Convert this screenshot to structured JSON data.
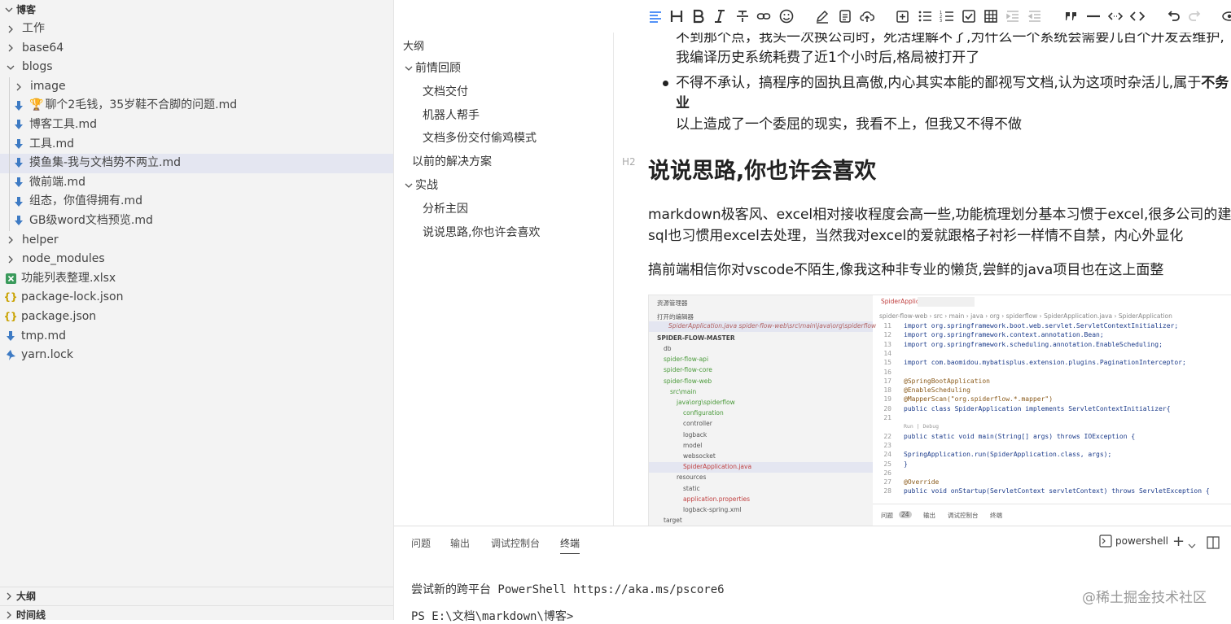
{
  "sidebar": {
    "workspace_title": "博客",
    "items": [
      {
        "label": "工作",
        "type": "folder",
        "state": "collapsed",
        "depth": 0
      },
      {
        "label": "base64",
        "type": "folder",
        "state": "collapsed",
        "depth": 0
      },
      {
        "label": "blogs",
        "type": "folder",
        "state": "expanded",
        "depth": 0
      },
      {
        "label": "image",
        "type": "folder",
        "state": "collapsed",
        "depth": 1
      },
      {
        "label": "聊个2毛钱，35岁鞋不合脚的问题.md",
        "type": "md",
        "depth": 1,
        "trophy": true
      },
      {
        "label": "博客工具.md",
        "type": "md",
        "depth": 1
      },
      {
        "label": "工具.md",
        "type": "md",
        "depth": 1
      },
      {
        "label": "摸鱼集-我与文档势不两立.md",
        "type": "md",
        "depth": 1,
        "selected": true
      },
      {
        "label": "微前端.md",
        "type": "md",
        "depth": 1
      },
      {
        "label": "组态，你值得拥有.md",
        "type": "md",
        "depth": 1
      },
      {
        "label": "GB级word文档预览.md",
        "type": "md",
        "depth": 1
      },
      {
        "label": "helper",
        "type": "folder",
        "state": "collapsed",
        "depth": 0
      },
      {
        "label": "node_modules",
        "type": "folder",
        "state": "collapsed",
        "depth": 0
      },
      {
        "label": "功能列表整理.xlsx",
        "type": "xlsx",
        "depth": 0
      },
      {
        "label": "package-lock.json",
        "type": "json",
        "depth": 0
      },
      {
        "label": "package.json",
        "type": "json",
        "depth": 0
      },
      {
        "label": "tmp.md",
        "type": "md",
        "depth": 0
      },
      {
        "label": "yarn.lock",
        "type": "yarn",
        "depth": 0
      }
    ],
    "outline_section": "大纲",
    "timeline_section": "时间线"
  },
  "toolbar": {
    "icons": [
      "align-icon",
      "heading-icon",
      "bold-icon",
      "italic-icon",
      "strikethrough-icon",
      "link-icon",
      "emoji-icon",
      "edit-icon",
      "export-icon",
      "upload-icon",
      "insert-icon",
      "bullet-list-icon",
      "numbered-list-icon",
      "task-list-icon",
      "table-icon",
      "indent-icon",
      "outdent-icon",
      "quote-icon",
      "hr-icon",
      "inline-code-icon",
      "code-block-icon",
      "undo-icon",
      "redo-icon",
      "preview-icon"
    ]
  },
  "outline": {
    "title": "大纲",
    "items": [
      {
        "label": "前情回顾",
        "level": 1,
        "expandable": true
      },
      {
        "label": "文档交付",
        "level": 2
      },
      {
        "label": "机器人帮手",
        "level": 2
      },
      {
        "label": "文档多份交付偷鸡模式",
        "level": 2
      },
      {
        "label": "以前的解决方案",
        "level": 1
      },
      {
        "label": "实战",
        "level": 1,
        "expandable": true
      },
      {
        "label": "分析主因",
        "level": 2
      },
      {
        "label": "说说思路,你也许会喜欢",
        "level": 2
      }
    ]
  },
  "editor": {
    "line1": "不到那个点，我头一次换公司时，死活理解不了,为什么一个系统会需要几百个开发去维护,",
    "line2": "我编译历史系统耗费了近1个小时后,格局被打开了",
    "bullet_text": "不得不承认，搞程序的固执且高傲,内心其实本能的鄙视写文档,认为这项时杂活儿,属于",
    "bullet_bold": "不务",
    "bullet_bold2": "业",
    "line_after": "以上造成了一个委屈的现实，我看不上，但我又不得不做",
    "h2_tag": "H2",
    "h2": "说说思路,你也许会喜欢",
    "p1_line1": "markdown极客风、excel相对接收程度会高一些,功能梳理划分基本习惯于excel,很多公司的建表",
    "p1_line2": "sql也习惯用excel去处理，当然我对excel的爱就跟格子衬衫一样情不自禁，内心外显化",
    "p2": "搞前端相信你对vscode不陌生,像我这种非专业的懒货,尝鲜的java项目也在这上面整"
  },
  "shot": {
    "explorer_title": "资源管理器",
    "open_editors": "打开的编辑器",
    "open_file": "SpiderApplication.java  spider-flow-web\\src\\main\\java\\org\\spiderflow",
    "project": "SPIDER-FLOW-MASTER",
    "tree": [
      "db",
      "spider-flow-api",
      "spider-flow-core",
      "spider-flow-web",
      "src\\main",
      "java\\org\\spiderflow",
      "configuration",
      "controller",
      "logback",
      "model",
      "websocket",
      "SpiderApplication.java",
      "resources",
      "static",
      "application.properties",
      "logback-spring.xml",
      "target"
    ],
    "tab": "SpiderApplication.java",
    "breadcrumb": "spider-flow-web › src › main › java › org › spiderflow › SpiderApplication.java › SpiderApplication",
    "code_lines": [
      {
        "n": "11",
        "t": "import org.springframework.boot.web.servlet.ServletContextInitializer;"
      },
      {
        "n": "12",
        "t": "import org.springframework.context.annotation.Bean;"
      },
      {
        "n": "13",
        "t": "import org.springframework.scheduling.annotation.EnableScheduling;"
      },
      {
        "n": "14",
        "t": ""
      },
      {
        "n": "15",
        "t": "import com.baomidou.mybatisplus.extension.plugins.PaginationInterceptor;"
      },
      {
        "n": "16",
        "t": ""
      },
      {
        "n": "17",
        "t": "@SpringBootApplication"
      },
      {
        "n": "18",
        "t": "@EnableScheduling"
      },
      {
        "n": "19",
        "t": "@MapperScan(\"org.spiderflow.*.mapper\")"
      },
      {
        "n": "20",
        "t": "public class SpiderApplication implements ServletContextInitializer{"
      },
      {
        "n": "21",
        "t": ""
      },
      {
        "n": "",
        "t": "    Run | Debug"
      },
      {
        "n": "22",
        "t": "    public static void main(String[] args) throws IOException {"
      },
      {
        "n": "23",
        "t": ""
      },
      {
        "n": "24",
        "t": "        SpringApplication.run(SpiderApplication.class, args);"
      },
      {
        "n": "25",
        "t": "    }"
      },
      {
        "n": "26",
        "t": ""
      },
      {
        "n": "27",
        "t": "    @Override"
      },
      {
        "n": "28",
        "t": "    public void onStartup(ServletContext servletContext) throws ServletException {"
      }
    ],
    "bottom_tabs": [
      "问题",
      "24",
      "输出",
      "调试控制台",
      "终端"
    ]
  },
  "panel": {
    "tabs": [
      "问题",
      "输出",
      "调试控制台",
      "终端"
    ],
    "active_tab": "终端",
    "shell": "powershell",
    "terminal_line1": "尝试新的跨平台 PowerShell https://aka.ms/pscore6",
    "terminal_line2": "PS E:\\文档\\markdown\\博客>",
    "watermark": "@稀土掘金技术社区"
  }
}
